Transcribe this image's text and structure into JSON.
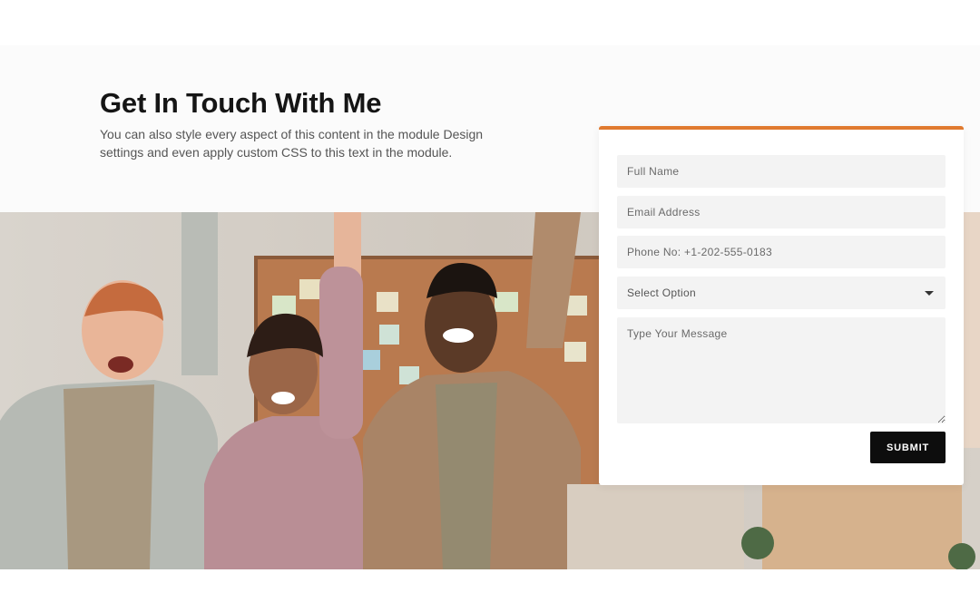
{
  "header": {
    "title": "Get In Touch With Me",
    "description": "You can also style every aspect of this content in the module Design settings and even apply custom CSS to this text in the module."
  },
  "form": {
    "accent_color": "#e07a2f",
    "full_name_placeholder": "Full Name",
    "email_placeholder": "Email Address",
    "phone_placeholder": "Phone No: +1-202-555-0183",
    "select_label": "Select Option",
    "message_placeholder": "Type Your Message",
    "submit_label": "SUBMIT"
  },
  "image": {
    "subject": "group-of-cheering-coworkers-photo"
  }
}
